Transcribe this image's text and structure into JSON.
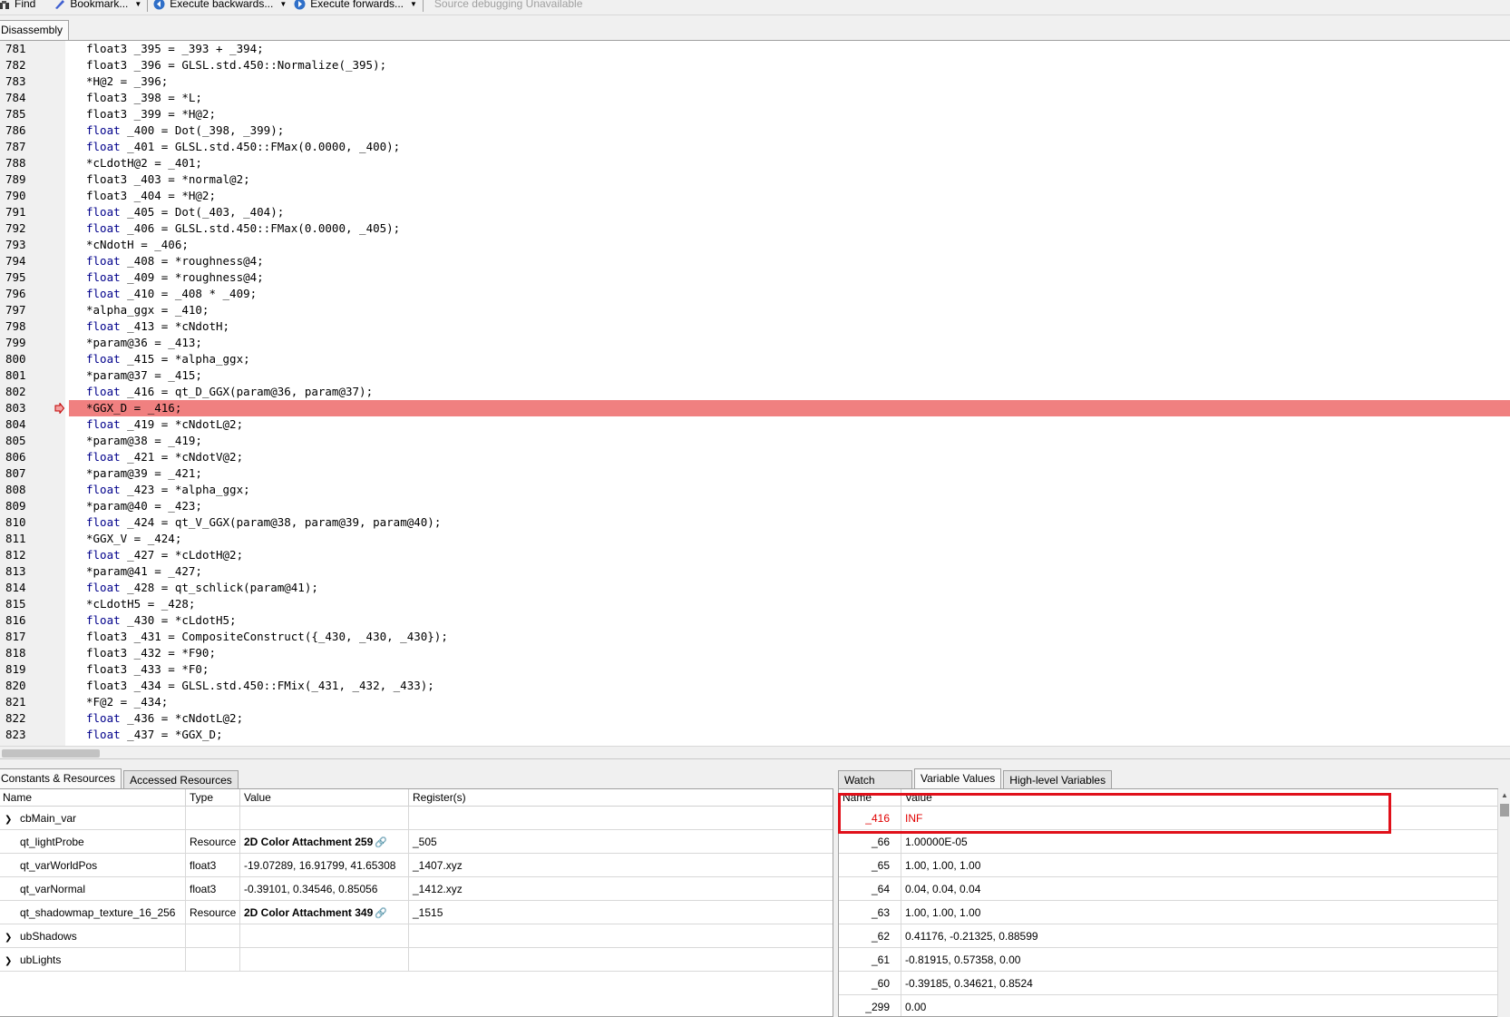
{
  "toolbar": {
    "find": "Find",
    "bookmark": "Bookmark...",
    "exec_back": "Execute backwards...",
    "exec_fwd": "Execute forwards...",
    "source_debug": "Source debugging Unavailable"
  },
  "code_tab": "Disassembly",
  "code_lines": [
    {
      "n": "781",
      "k": "",
      "t": "float3 _395 = _393 + _394;"
    },
    {
      "n": "782",
      "k": "",
      "t": "float3 _396 = GLSL.std.450::Normalize(_395);"
    },
    {
      "n": "783",
      "k": "",
      "t": "*H@2 = _396;"
    },
    {
      "n": "784",
      "k": "",
      "t": "float3 _398 = *L;"
    },
    {
      "n": "785",
      "k": "",
      "t": "float3 _399 = *H@2;"
    },
    {
      "n": "786",
      "k": "float",
      "t": " _400 = Dot(_398, _399);"
    },
    {
      "n": "787",
      "k": "float",
      "t": " _401 = GLSL.std.450::FMax(0.0000, _400);"
    },
    {
      "n": "788",
      "k": "",
      "t": "*cLdotH@2 = _401;"
    },
    {
      "n": "789",
      "k": "",
      "t": "float3 _403 = *normal@2;"
    },
    {
      "n": "790",
      "k": "",
      "t": "float3 _404 = *H@2;"
    },
    {
      "n": "791",
      "k": "float",
      "t": " _405 = Dot(_403, _404);"
    },
    {
      "n": "792",
      "k": "float",
      "t": " _406 = GLSL.std.450::FMax(0.0000, _405);"
    },
    {
      "n": "793",
      "k": "",
      "t": "*cNdotH = _406;"
    },
    {
      "n": "794",
      "k": "float",
      "t": " _408 = *roughness@4;"
    },
    {
      "n": "795",
      "k": "float",
      "t": " _409 = *roughness@4;"
    },
    {
      "n": "796",
      "k": "float",
      "t": " _410 = _408 * _409;"
    },
    {
      "n": "797",
      "k": "",
      "t": "*alpha_ggx = _410;"
    },
    {
      "n": "798",
      "k": "float",
      "t": " _413 = *cNdotH;"
    },
    {
      "n": "799",
      "k": "",
      "t": "*param@36 = _413;"
    },
    {
      "n": "800",
      "k": "float",
      "t": " _415 = *alpha_ggx;"
    },
    {
      "n": "801",
      "k": "",
      "t": "*param@37 = _415;"
    },
    {
      "n": "802",
      "k": "float",
      "t": " _416 = qt_D_GGX(param@36, param@37);"
    },
    {
      "n": "803",
      "k": "",
      "t": "*GGX_D = _416;",
      "current": true
    },
    {
      "n": "804",
      "k": "float",
      "t": " _419 = *cNdotL@2;"
    },
    {
      "n": "805",
      "k": "",
      "t": "*param@38 = _419;"
    },
    {
      "n": "806",
      "k": "float",
      "t": " _421 = *cNdotV@2;"
    },
    {
      "n": "807",
      "k": "",
      "t": "*param@39 = _421;"
    },
    {
      "n": "808",
      "k": "float",
      "t": " _423 = *alpha_ggx;"
    },
    {
      "n": "809",
      "k": "",
      "t": "*param@40 = _423;"
    },
    {
      "n": "810",
      "k": "float",
      "t": " _424 = qt_V_GGX(param@38, param@39, param@40);"
    },
    {
      "n": "811",
      "k": "",
      "t": "*GGX_V = _424;"
    },
    {
      "n": "812",
      "k": "float",
      "t": " _427 = *cLdotH@2;"
    },
    {
      "n": "813",
      "k": "",
      "t": "*param@41 = _427;"
    },
    {
      "n": "814",
      "k": "float",
      "t": " _428 = qt_schlick(param@41);"
    },
    {
      "n": "815",
      "k": "",
      "t": "*cLdotH5 = _428;"
    },
    {
      "n": "816",
      "k": "float",
      "t": " _430 = *cLdotH5;"
    },
    {
      "n": "817",
      "k": "",
      "t": "float3 _431 = CompositeConstruct({_430, _430, _430});"
    },
    {
      "n": "818",
      "k": "",
      "t": "float3 _432 = *F90;"
    },
    {
      "n": "819",
      "k": "",
      "t": "float3 _433 = *F0;"
    },
    {
      "n": "820",
      "k": "",
      "t": "float3 _434 = GLSL.std.450::FMix(_431, _432, _433);"
    },
    {
      "n": "821",
      "k": "",
      "t": "*F@2 = _434;"
    },
    {
      "n": "822",
      "k": "float",
      "t": " _436 = *cNdotL@2;"
    },
    {
      "n": "823",
      "k": "float",
      "t": " _437 = *GGX_D;"
    }
  ],
  "left_tabs": [
    "Constants & Resources",
    "Accessed Resources"
  ],
  "left_headers": [
    "Name",
    "Type",
    "Value",
    "Register(s)"
  ],
  "left_rows": [
    {
      "name": "cbMain_var",
      "type": "",
      "value": "",
      "reg": "",
      "expand": true
    },
    {
      "name": "qt_lightProbe",
      "type": "Resource",
      "value": "2D Color Attachment 259",
      "reg": "_505",
      "bold": true,
      "link": true
    },
    {
      "name": "qt_varWorldPos",
      "type": "float3",
      "value": "-19.07289, 16.91799, 41.65308",
      "reg": "_1407.xyz"
    },
    {
      "name": "qt_varNormal",
      "type": "float3",
      "value": "-0.39101, 0.34546, 0.85056",
      "reg": "_1412.xyz"
    },
    {
      "name": "qt_shadowmap_texture_16_256",
      "type": "Resource",
      "value": "2D Color Attachment 349",
      "reg": "_1515",
      "bold": true,
      "link": true
    },
    {
      "name": "ubShadows",
      "type": "",
      "value": "",
      "reg": "",
      "expand": true
    },
    {
      "name": "ubLights",
      "type": "",
      "value": "",
      "reg": "",
      "expand": true
    }
  ],
  "right_tabs": [
    "Watch",
    "Variable Values",
    "High-level Variables"
  ],
  "right_headers": [
    "Name",
    "Value"
  ],
  "right_rows": [
    {
      "name": "_416",
      "value": "INF",
      "changed": true
    },
    {
      "name": "_66",
      "value": "1.00000E-05"
    },
    {
      "name": "_65",
      "value": "1.00, 1.00, 1.00"
    },
    {
      "name": "_64",
      "value": "0.04, 0.04, 0.04"
    },
    {
      "name": "_63",
      "value": "1.00, 1.00, 1.00"
    },
    {
      "name": "_62",
      "value": "0.41176, -0.21325, 0.88599"
    },
    {
      "name": "_61",
      "value": "-0.81915, 0.57358, 0.00"
    },
    {
      "name": "_60",
      "value": "-0.39185, 0.34621, 0.8524"
    },
    {
      "name": "_299",
      "value": "0.00"
    }
  ],
  "colors": {
    "current_line": "#f08080",
    "changed_value": "#e00000",
    "annotation_box": "#e0101a",
    "keyword": "#00008b"
  }
}
